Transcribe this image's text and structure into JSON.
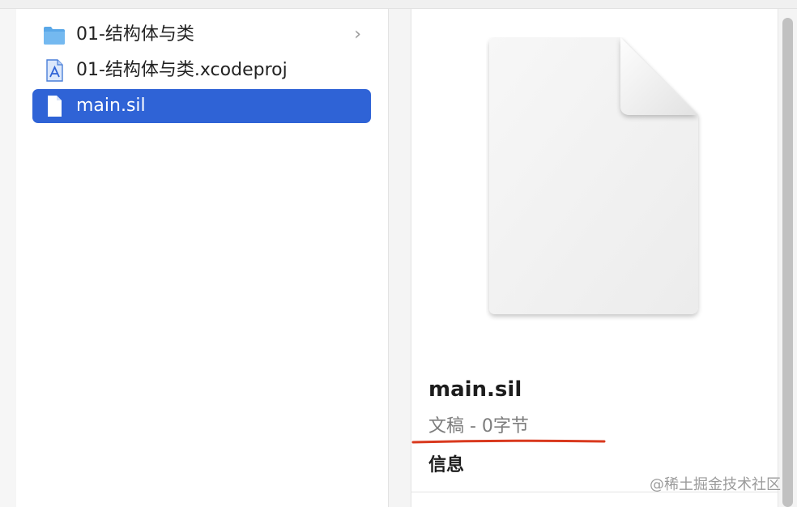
{
  "files": [
    {
      "name": "01-结构体与类",
      "icon": "folder-icon",
      "has_children": true,
      "chevron": "›",
      "selected": false
    },
    {
      "name": "01-结构体与类.xcodeproj",
      "icon": "xcodeproj-icon",
      "has_children": false,
      "selected": false
    },
    {
      "name": "main.sil",
      "icon": "document-icon",
      "has_children": false,
      "selected": true
    }
  ],
  "preview": {
    "filename": "main.sil",
    "meta": "文稿 - 0字节",
    "info_heading": "信息"
  },
  "watermark": "@稀土掘金技术社区",
  "colors": {
    "selection": "#2f63d6",
    "folder": "#5aa8e8",
    "underline": "#d9391e"
  }
}
